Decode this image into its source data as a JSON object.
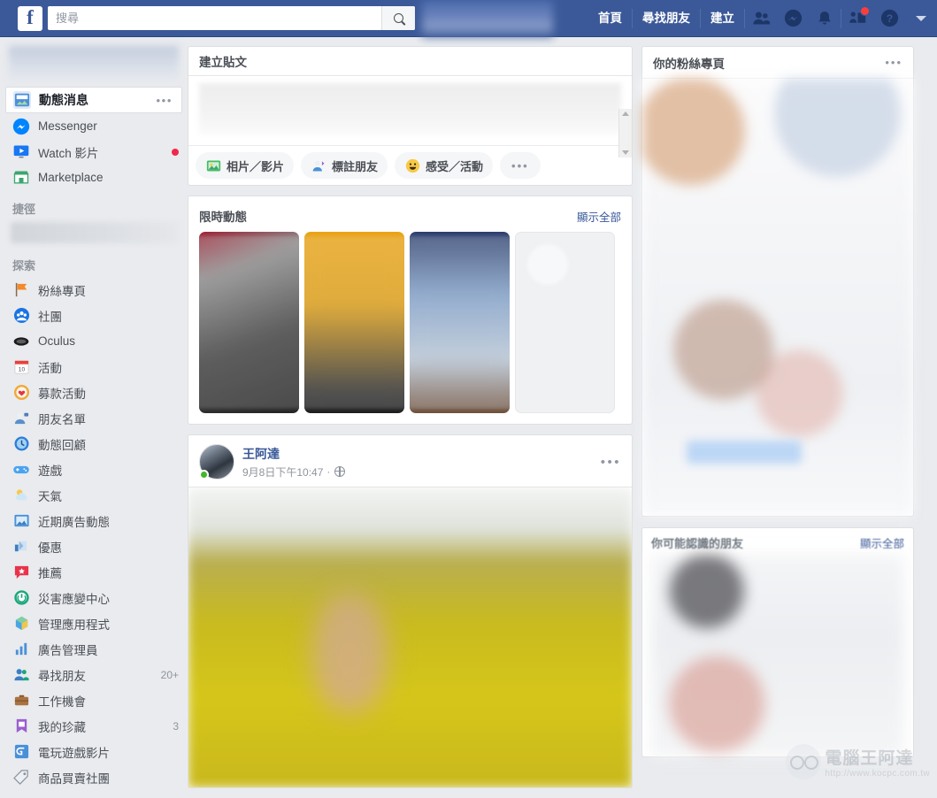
{
  "topbar": {
    "logo": "f",
    "search": {
      "placeholder": "搜尋",
      "value": "",
      "icon": "search-icon"
    },
    "nav_links": [
      {
        "label": "首頁",
        "name": "home"
      },
      {
        "label": "尋找朋友",
        "name": "find-friends"
      },
      {
        "label": "建立",
        "name": "create"
      }
    ],
    "icons": [
      {
        "name": "friend-requests-icon"
      },
      {
        "name": "messenger-icon"
      },
      {
        "name": "notifications-icon"
      },
      {
        "name": "pages-feed-icon",
        "badge": true
      },
      {
        "name": "help-icon"
      },
      {
        "name": "account-dropdown-icon"
      }
    ],
    "bg_color": "#3b5998"
  },
  "sidebar": {
    "main_items": [
      {
        "label": "動態消息",
        "icon": "news-feed-icon",
        "active": true,
        "menu": "•••"
      },
      {
        "label": "Messenger",
        "icon": "messenger-icon"
      },
      {
        "label": "Watch 影片",
        "icon": "watch-icon",
        "dot": true
      },
      {
        "label": "Marketplace",
        "icon": "marketplace-icon"
      }
    ],
    "shortcuts_title": "捷徑",
    "explore_title": "探索",
    "explore_items": [
      {
        "label": "粉絲專頁",
        "icon": "pages-icon"
      },
      {
        "label": "社團",
        "icon": "groups-icon"
      },
      {
        "label": "Oculus",
        "icon": "oculus-icon"
      },
      {
        "label": "活動",
        "icon": "events-icon"
      },
      {
        "label": "募款活動",
        "icon": "fundraisers-icon"
      },
      {
        "label": "朋友名單",
        "icon": "friend-lists-icon"
      },
      {
        "label": "動態回顧",
        "icon": "memories-icon"
      },
      {
        "label": "遊戲",
        "icon": "games-icon"
      },
      {
        "label": "天氣",
        "icon": "weather-icon"
      },
      {
        "label": "近期廣告動態",
        "icon": "recent-ad-activity-icon"
      },
      {
        "label": "優惠",
        "icon": "offers-icon"
      },
      {
        "label": "推薦",
        "icon": "recommendations-icon"
      },
      {
        "label": "災害應變中心",
        "icon": "crisis-response-icon"
      },
      {
        "label": "管理應用程式",
        "icon": "manage-apps-icon"
      },
      {
        "label": "廣告管理員",
        "icon": "ads-manager-icon"
      },
      {
        "label": "尋找朋友",
        "icon": "find-friends-icon",
        "badge": "20+"
      },
      {
        "label": "工作機會",
        "icon": "jobs-icon"
      },
      {
        "label": "我的珍藏",
        "icon": "saved-icon",
        "badge": "3"
      },
      {
        "label": "電玩遊戲影片",
        "icon": "gaming-video-icon"
      },
      {
        "label": "商品買賣社團",
        "icon": "buy-sell-groups-icon"
      }
    ]
  },
  "compose": {
    "title": "建立貼文",
    "actions": [
      {
        "label": "相片／影片",
        "icon": "photo-video-icon"
      },
      {
        "label": "標註朋友",
        "icon": "tag-friends-icon"
      },
      {
        "label": "感受／活動",
        "icon": "feeling-activity-icon"
      }
    ],
    "more_label": "•••"
  },
  "stories": {
    "title": "限時動態",
    "show_all": "顯示全部",
    "cards": [
      {
        "name": "story-1"
      },
      {
        "name": "story-2"
      },
      {
        "name": "story-3"
      },
      {
        "name": "add-story"
      }
    ]
  },
  "post": {
    "author": "王阿達",
    "timestamp": "9月8日下午10:47",
    "separator": "·",
    "privacy_icon": "globe-icon",
    "menu": "•••"
  },
  "right": {
    "pages_panel": {
      "title": "你的粉絲專頁",
      "menu": "•••"
    },
    "pymk_panel": {
      "title": "你可能認識的朋友",
      "show_all": "顯示全部"
    }
  },
  "watermark": {
    "title": "電腦王阿達",
    "url": "http://www.kocpc.com.tw"
  }
}
